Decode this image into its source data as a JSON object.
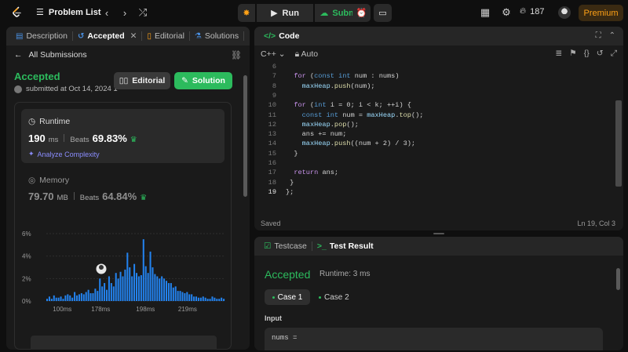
{
  "topbar": {
    "title": "Problem List",
    "run_label": "Run",
    "submit_label": "Submit",
    "streak": "187",
    "premium_label": "Premium"
  },
  "left_panel": {
    "tabs": [
      {
        "label": "Description",
        "icon": "description-icon"
      },
      {
        "label": "Accepted",
        "icon": "history-icon",
        "active": true
      },
      {
        "label": "Editorial",
        "icon": "book-icon"
      },
      {
        "label": "Solutions",
        "icon": "flask-icon"
      }
    ],
    "back_label": "All Submissions",
    "status": "Accepted",
    "submitted": "submitted at Oct 14, 2024 1",
    "editorial_btn": "Editorial",
    "solution_btn": "Solution",
    "runtime": {
      "title": "Runtime",
      "value": "190",
      "unit": "ms",
      "beats_label": "Beats",
      "beats_pct": "69.83%",
      "analyze": "Analyze Complexity"
    },
    "memory": {
      "title": "Memory",
      "value": "79.70",
      "unit": "MB",
      "beats_label": "Beats",
      "beats_pct": "64.84%"
    }
  },
  "chart_data": {
    "type": "bar",
    "ytick_labels": [
      "6%",
      "4%",
      "2%",
      "0%"
    ],
    "ylim": [
      0,
      6
    ],
    "xtick_labels": [
      "100ms",
      "178ms",
      "198ms",
      "219ms"
    ],
    "values": [
      0.2,
      0.4,
      0.2,
      0.5,
      0.3,
      0.3,
      0.4,
      0.2,
      0.5,
      0.6,
      0.5,
      0.3,
      0.8,
      0.5,
      0.6,
      0.7,
      0.6,
      0.8,
      1.0,
      0.7,
      0.7,
      1.1,
      0.9,
      2.0,
      1.3,
      1.6,
      1.0,
      2.2,
      1.6,
      1.3,
      2.5,
      2.0,
      2.6,
      2.2,
      2.8,
      4.3,
      3.0,
      2.2,
      3.3,
      2.5,
      2.2,
      2.3,
      5.5,
      3.1,
      2.5,
      4.4,
      3.0,
      2.4,
      2.2,
      2.0,
      2.2,
      2.0,
      1.8,
      1.6,
      1.6,
      1.2,
      1.3,
      0.9,
      0.9,
      0.8,
      0.7,
      0.8,
      0.6,
      0.6,
      0.4,
      0.4,
      0.3,
      0.3,
      0.4,
      0.3,
      0.2,
      0.2,
      0.4,
      0.3,
      0.2,
      0.2,
      0.3,
      0.2
    ],
    "highlight_color": "#1e75d8",
    "bar_color": "#2383ef"
  },
  "code_panel": {
    "title": "Code",
    "language": "C++",
    "mode": "Auto",
    "status": "Saved",
    "cursor": "Ln 19, Col 3",
    "lines": [
      {
        "n": "6",
        "t": ""
      },
      {
        "n": "7",
        "t": "  for (const int num : nums)"
      },
      {
        "n": "8",
        "t": "    maxHeap.push(num);"
      },
      {
        "n": "9",
        "t": ""
      },
      {
        "n": "10",
        "t": "  for (int i = 0; i < k; ++i) {"
      },
      {
        "n": "11",
        "t": "    const int num = maxHeap.top();"
      },
      {
        "n": "12",
        "t": "    maxHeap.pop();"
      },
      {
        "n": "13",
        "t": "    ans += num;"
      },
      {
        "n": "14",
        "t": "    maxHeap.push((num + 2) / 3);"
      },
      {
        "n": "15",
        "t": "  }"
      },
      {
        "n": "16",
        "t": ""
      },
      {
        "n": "17",
        "t": "  return ans;"
      },
      {
        "n": "18",
        "t": " }"
      },
      {
        "n": "19",
        "t": "};"
      }
    ]
  },
  "result_panel": {
    "tabs": [
      {
        "label": "Testcase"
      },
      {
        "label": "Test Result",
        "active": true
      }
    ],
    "status": "Accepted",
    "runtime": "Runtime: 3 ms",
    "cases": [
      "Case 1",
      "Case 2"
    ],
    "input_label": "Input",
    "input_value": "nums ="
  },
  "colors": {
    "accent_green": "#2cbb5d",
    "premium": "#ffa116",
    "bg": "#0f0f0f",
    "panel": "#1a1a1a"
  }
}
